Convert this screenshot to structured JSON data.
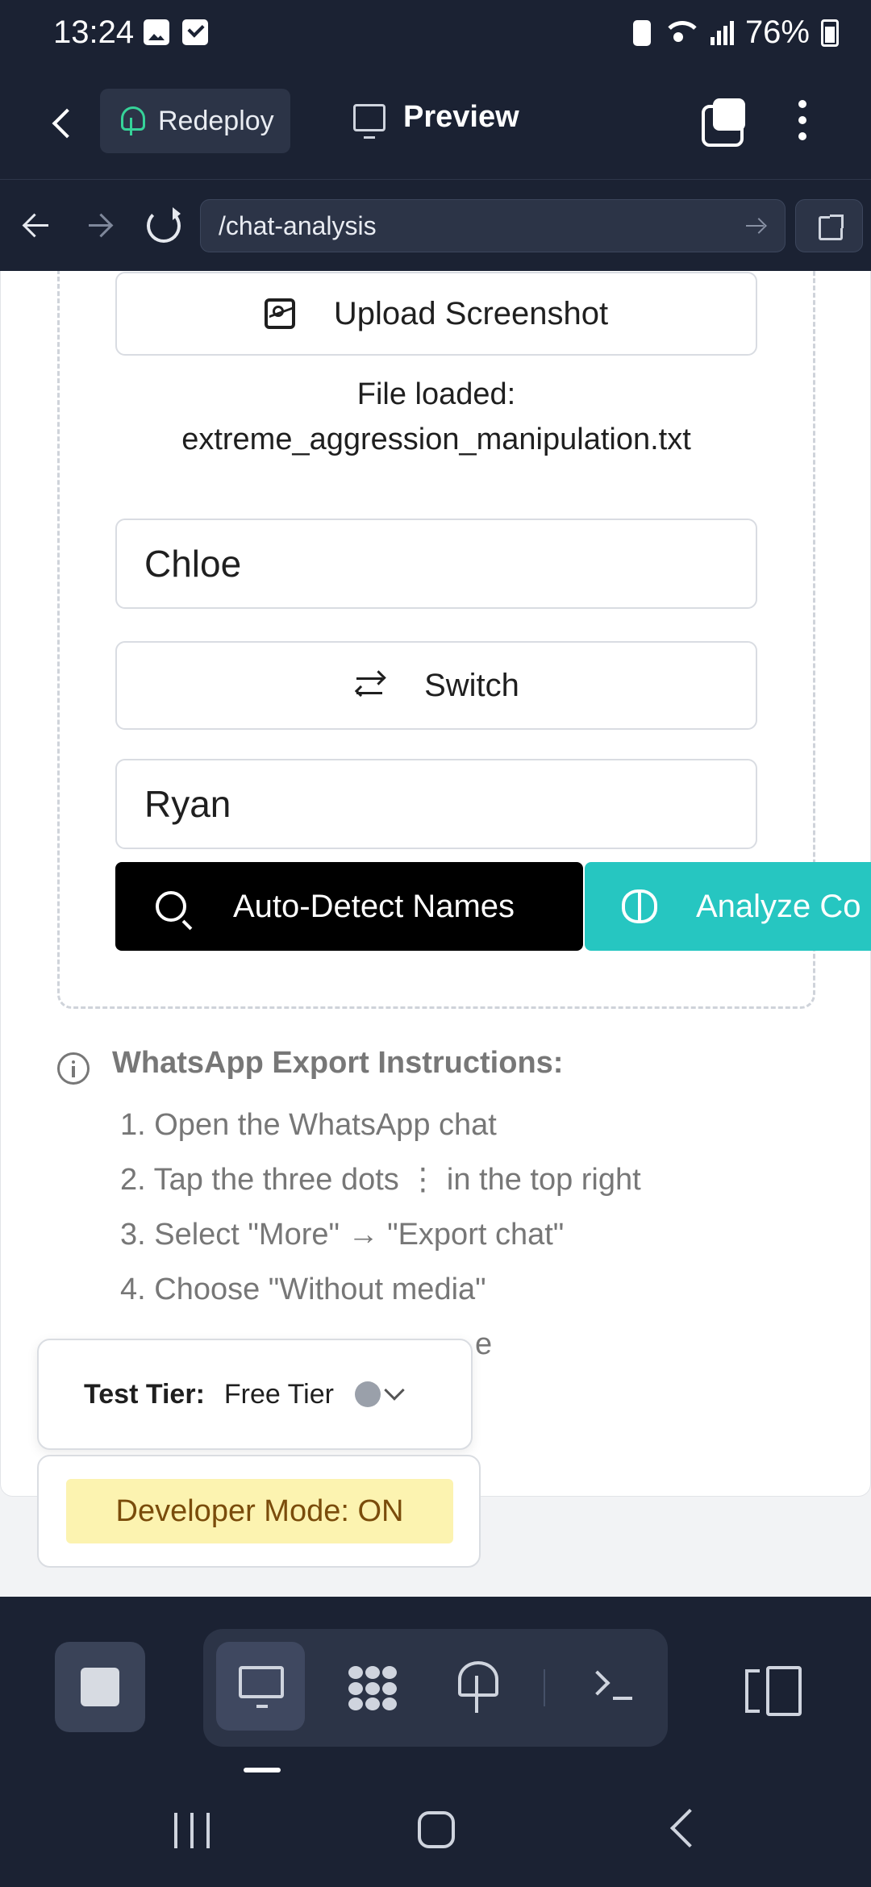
{
  "status_bar": {
    "time": "13:24",
    "battery": "76%",
    "icons": [
      "gallery-icon",
      "checkbox-icon",
      "wifi-icon",
      "signal-icon",
      "battery-icon"
    ]
  },
  "toolbar": {
    "redeploy_label": "Redeploy",
    "preview_label": "Preview"
  },
  "urlbar": {
    "url": "/chat-analysis"
  },
  "analysis": {
    "upload_label": "Upload Screenshot",
    "file_loaded_label": "File loaded:",
    "file_name": "extreme_aggression_manipulation.txt",
    "person1": "Chloe",
    "switch_label": "Switch",
    "person2": "Ryan",
    "auto_detect_label": "Auto-Detect Names",
    "analyze_label": "Analyze Co"
  },
  "instructions": {
    "title": "WhatsApp Export Instructions:",
    "steps": [
      "1. Open the WhatsApp chat",
      "2. Tap the three dots ⋮ in the top right",
      "3. Select \"More\" → \"Export chat\"",
      "4. Choose \"Without media\"",
      "e"
    ]
  },
  "dev": {
    "tier_label": "Test Tier:",
    "tier_value": "Free Tier",
    "mode_badge": "Developer Mode: ON"
  },
  "colors": {
    "chrome_bg": "#1b2233",
    "accent_teal": "#26c6c1",
    "redeploy_green": "#36d399",
    "dev_badge_bg": "#fcf3b0",
    "dev_badge_text": "#7a4c0b"
  }
}
